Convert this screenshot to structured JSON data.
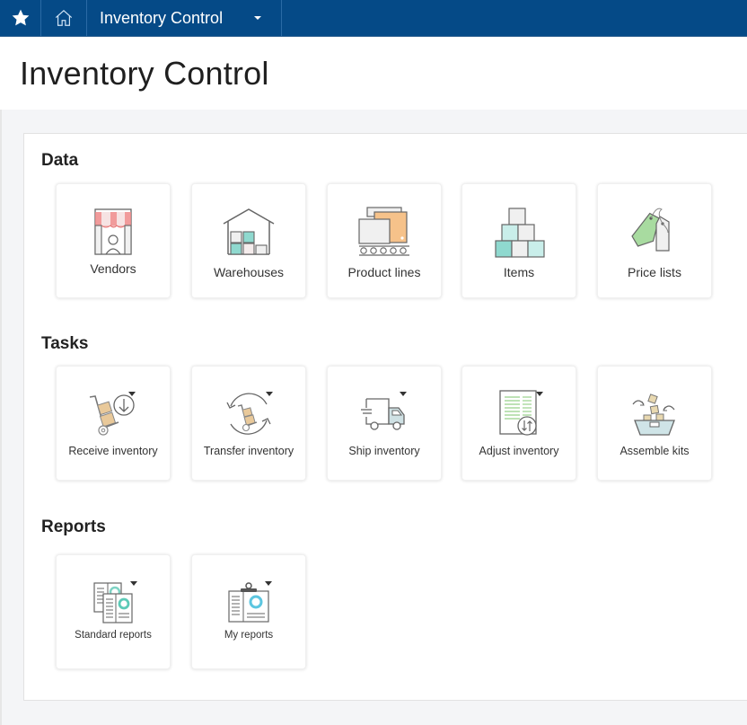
{
  "topbar": {
    "favorites_icon": "star-icon",
    "home_icon": "home-icon",
    "module_label": "Inventory Control",
    "module_dropdown_icon": "caret-down-icon",
    "background_color": "#054a87"
  },
  "header": {
    "title": "Inventory Control"
  },
  "sections": {
    "data": {
      "title": "Data",
      "tiles": [
        {
          "label": "Vendors",
          "icon": "vendor-storefront-icon"
        },
        {
          "label": "Warehouses",
          "icon": "warehouse-icon"
        },
        {
          "label": "Product lines",
          "icon": "product-lines-icon"
        },
        {
          "label": "Items",
          "icon": "items-boxes-icon"
        },
        {
          "label": "Price lists",
          "icon": "price-tags-icon"
        }
      ]
    },
    "tasks": {
      "title": "Tasks",
      "tiles": [
        {
          "label": "Receive inventory",
          "icon": "receive-dolly-icon",
          "has_dropdown": true
        },
        {
          "label": "Transfer inventory",
          "icon": "transfer-dolly-icon",
          "has_dropdown": true
        },
        {
          "label": "Ship inventory",
          "icon": "delivery-truck-icon",
          "has_dropdown": true
        },
        {
          "label": "Adjust inventory",
          "icon": "adjust-document-icon",
          "has_dropdown": true
        },
        {
          "label": "Assemble kits",
          "icon": "assemble-basket-icon",
          "has_dropdown": false
        }
      ]
    },
    "reports": {
      "title": "Reports",
      "tiles": [
        {
          "label": "Standard reports",
          "icon": "standard-reports-icon",
          "has_dropdown": true
        },
        {
          "label": "My reports",
          "icon": "clipboard-report-icon",
          "has_dropdown": true
        }
      ]
    }
  },
  "colors": {
    "accent_teal": "#8fd9cf",
    "accent_orange": "#f6c28a",
    "accent_red": "#ef8a8a",
    "accent_green": "#a8dba0",
    "box_tan": "#e9c99a",
    "icon_stroke": "#666666"
  }
}
